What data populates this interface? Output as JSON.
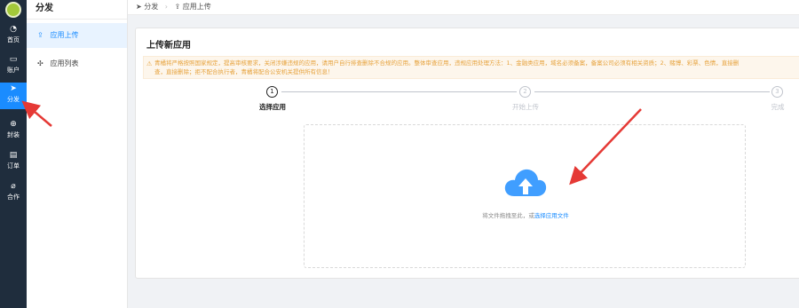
{
  "nav": {
    "items": [
      {
        "label": "首页",
        "icon": "dashboard-icon",
        "glyph": "◔"
      },
      {
        "label": "账户",
        "icon": "folder-icon",
        "glyph": "▭"
      },
      {
        "label": "分发",
        "icon": "send-icon",
        "glyph": "➤",
        "active": true
      },
      {
        "label": "封装",
        "icon": "plus-circle-icon",
        "glyph": "⊕"
      },
      {
        "label": "订单",
        "icon": "clipboard-icon",
        "glyph": "▤"
      },
      {
        "label": "合作",
        "icon": "paperclip-icon",
        "glyph": "⌀"
      }
    ]
  },
  "submenu": {
    "title": "分发",
    "items": [
      {
        "label": "应用上传",
        "icon": "upload-icon",
        "glyph": "⇪",
        "active": true
      },
      {
        "label": "应用列表",
        "icon": "puzzle-icon",
        "glyph": "✣"
      }
    ]
  },
  "breadcrumb": {
    "first": "分发",
    "first_glyph": "➤",
    "sep": "›",
    "second": "应用上传",
    "second_glyph": "⇪"
  },
  "card": {
    "title": "上传新应用",
    "alert_line1": "青橘将严格按照国家规定，提高审核要求，关闭涉嫌违规的应用，请用户自行排查删除不合规的应用。整体审查应用，违规应用处理方法：1、金融类应用，域名必须备案，备案公司必须有相关资质；2、赌博、彩票、色情，直接删",
    "alert_line2": "查，直接删除；拒不配合执行者，青橘将配合公安机关提供所有信息！",
    "alert_glyph": "⚠"
  },
  "steps": [
    {
      "num": "1",
      "label": "选择应用",
      "status": "done"
    },
    {
      "num": "2",
      "label": "开始上传",
      "status": "todo"
    },
    {
      "num": "3",
      "label": "完成",
      "status": "todo"
    }
  ],
  "upload": {
    "hint": "将文件拖拽至此，或",
    "link": "选择应用文件",
    "icon": "cloud-upload-icon",
    "color": "#409eff"
  },
  "colors": {
    "nav_bg": "#1f2d3d",
    "accent": "#1a8cff",
    "warning": "#e6a23c"
  }
}
